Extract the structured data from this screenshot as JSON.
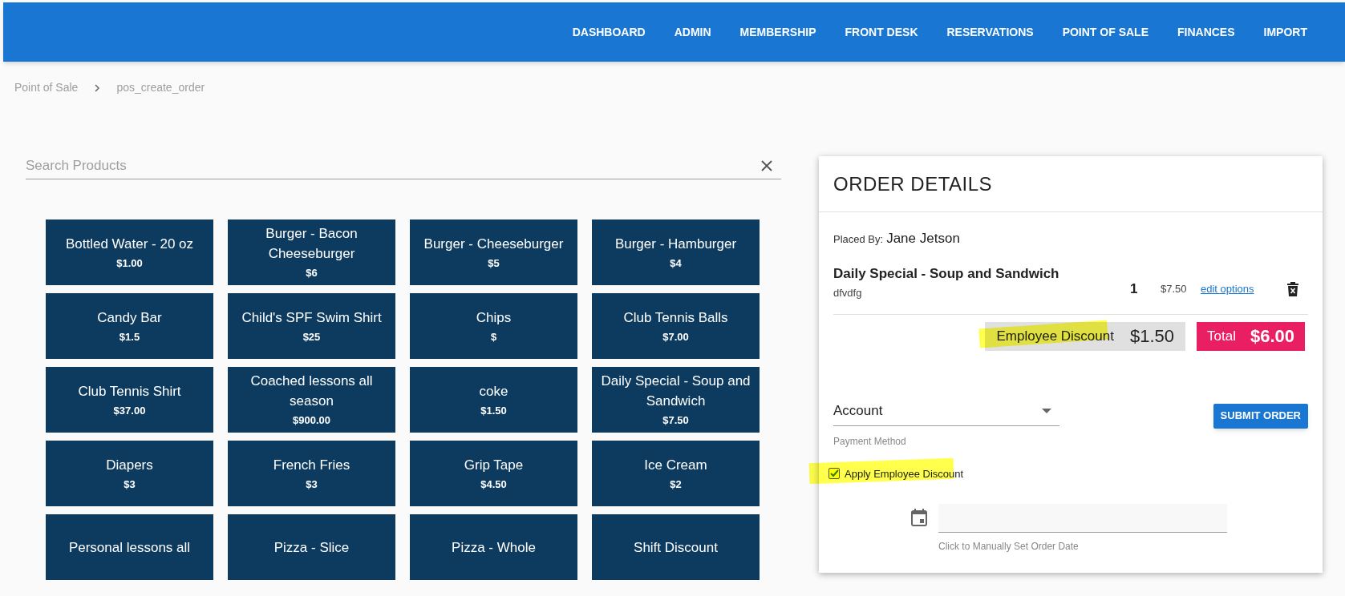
{
  "nav": {
    "items": [
      {
        "label": "DASHBOARD"
      },
      {
        "label": "ADMIN"
      },
      {
        "label": "MEMBERSHIP"
      },
      {
        "label": "FRONT DESK"
      },
      {
        "label": "RESERVATIONS"
      },
      {
        "label": "POINT OF SALE"
      },
      {
        "label": "FINANCES"
      },
      {
        "label": "IMPORT"
      }
    ]
  },
  "breadcrumb": [
    "Point of Sale",
    "pos_create_order"
  ],
  "search": {
    "placeholder": "Search Products"
  },
  "products": [
    {
      "name": "Bottled Water - 20 oz",
      "price": "$1.00"
    },
    {
      "name": "Burger - Bacon Cheeseburger",
      "price": "$6"
    },
    {
      "name": "Burger - Cheeseburger",
      "price": "$5"
    },
    {
      "name": "Burger - Hamburger",
      "price": "$4"
    },
    {
      "name": "Candy Bar",
      "price": "$1.5"
    },
    {
      "name": "Child's SPF Swim Shirt",
      "price": "$25"
    },
    {
      "name": "Chips",
      "price": "$"
    },
    {
      "name": "Club Tennis Balls",
      "price": "$7.00"
    },
    {
      "name": "Club Tennis Shirt",
      "price": "$37.00"
    },
    {
      "name": "Coached lessons all season",
      "price": "$900.00"
    },
    {
      "name": "coke",
      "price": "$1.50"
    },
    {
      "name": "Daily Special - Soup and Sandwich",
      "price": "$7.50"
    },
    {
      "name": "Diapers",
      "price": "$3"
    },
    {
      "name": "French Fries",
      "price": "$3"
    },
    {
      "name": "Grip Tape",
      "price": "$4.50"
    },
    {
      "name": "Ice Cream",
      "price": "$2"
    },
    {
      "name": "Personal lessons all"
    },
    {
      "name": "Pizza - Slice"
    },
    {
      "name": "Pizza - Whole"
    },
    {
      "name": "Shift Discount"
    }
  ],
  "order": {
    "title": "ORDER DETAILS",
    "placed_by_label": "Placed By:",
    "placed_by": "Jane Jetson",
    "items": [
      {
        "name": "Daily Special - Soup and Sandwich",
        "note": "dfvdfg",
        "qty": "1",
        "price": "$7.50",
        "link": "edit options"
      }
    ],
    "discount": {
      "label": "Employee Discount",
      "amount": "$1.50"
    },
    "total": {
      "label": "Total",
      "amount": "$6.00"
    },
    "payment": {
      "value": "Account",
      "helper": "Payment Method"
    },
    "submit": "SUBMIT ORDER",
    "discount_checkbox": {
      "label": "Apply Employee Discount",
      "checked": true
    },
    "date_field": {
      "helper": "Click to Manually Set Order Date"
    }
  }
}
